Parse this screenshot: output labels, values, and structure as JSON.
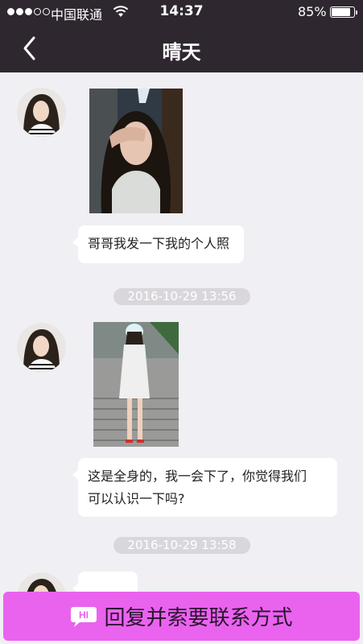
{
  "status_bar": {
    "carrier": "中国联通",
    "time": "14:37",
    "battery_percent": "85%",
    "battery_level": 0.85,
    "icons": [
      "signal-dots",
      "wifi-icon",
      "battery-icon"
    ]
  },
  "nav": {
    "title": "晴天",
    "back_icon": "chevron-left-icon"
  },
  "messages": [
    {
      "type": "image",
      "image_description": "photo-covering-face"
    },
    {
      "type": "text",
      "text": "哥哥我发一下我的个人照"
    },
    {
      "type": "timestamp",
      "text": "2016-10-29 13:56"
    },
    {
      "type": "image",
      "image_description": "full-body-photo"
    },
    {
      "type": "text",
      "line1": "这是全身的，我一会下了，你觉得我们",
      "line2": "可以认识一下吗?"
    },
    {
      "type": "timestamp",
      "text": "2016-10-29 13:58"
    }
  ],
  "bottom_bar": {
    "icon_text": "HI",
    "label": "回复并索要联系方式",
    "color": "#ea63ee"
  }
}
